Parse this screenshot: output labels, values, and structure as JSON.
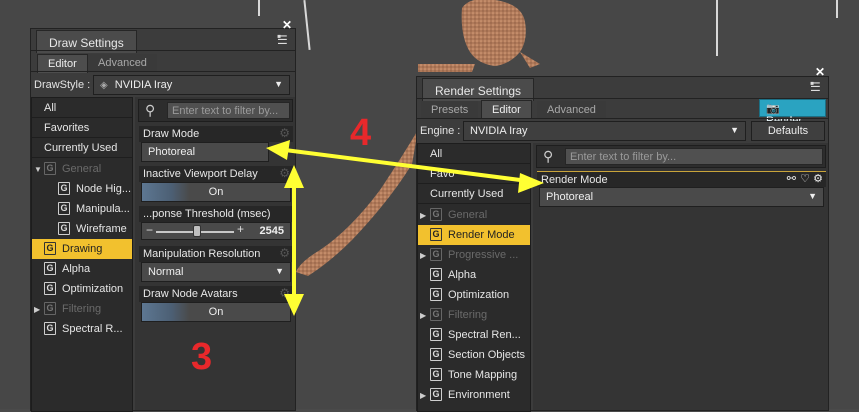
{
  "draw_panel": {
    "title": "Draw Settings",
    "tabs": [
      "Editor",
      "Advanced"
    ],
    "drawstyle_label": "DrawStyle :",
    "drawstyle_value": "NVIDIA Iray",
    "search_placeholder": "Enter text to filter by...",
    "sidebar": {
      "plain_items": [
        "All",
        "Favorites",
        "Currently Used"
      ],
      "groups": [
        {
          "label": "General",
          "expanded": true,
          "dim": true
        },
        {
          "label": "Node Hig...",
          "child": true
        },
        {
          "label": "Manipula...",
          "child": true
        },
        {
          "label": "Wireframe",
          "child": true
        },
        {
          "label": "Drawing",
          "selected": true
        },
        {
          "label": "Alpha"
        },
        {
          "label": "Optimization"
        },
        {
          "label": "Filtering",
          "dim": true
        },
        {
          "label": "Spectral R..."
        }
      ]
    },
    "properties": {
      "draw_mode_label": "Draw Mode",
      "draw_mode_value": "Photoreal",
      "inactive_delay_label": "Inactive Viewport Delay",
      "inactive_delay_value": "On",
      "threshold_label": "...ponse Threshold (msec)",
      "threshold_value": "2545",
      "manip_res_label": "Manipulation Resolution",
      "manip_res_value": "Normal",
      "avatars_label": "Draw Node Avatars",
      "avatars_value": "On"
    }
  },
  "render_panel": {
    "title": "Render Settings",
    "tabs": [
      "Presets",
      "Editor",
      "Advanced"
    ],
    "render_button": "Render",
    "engine_label": "Engine :",
    "engine_value": "NVIDIA Iray",
    "defaults_button": "Defaults",
    "search_placeholder": "Enter text to filter by...",
    "sidebar": {
      "plain_items": [
        "All",
        "Favo",
        "Currently Used"
      ],
      "groups": [
        {
          "label": "General",
          "dim": true
        },
        {
          "label": "Render Mode",
          "selected": true
        },
        {
          "label": "Progressive ...",
          "dim": true
        },
        {
          "label": "Alpha"
        },
        {
          "label": "Optimization"
        },
        {
          "label": "Filtering",
          "dim": true
        },
        {
          "label": "Spectral Ren..."
        },
        {
          "label": "Section Objects"
        },
        {
          "label": "Tone Mapping"
        },
        {
          "label": "Environment"
        }
      ]
    },
    "properties": {
      "render_mode_label": "Render Mode",
      "render_mode_value": "Photoreal"
    }
  },
  "annotations": {
    "step_3": "3",
    "step_4": "4"
  },
  "colors": {
    "selected": "#f2c12e",
    "arrow": "#ffff33",
    "annotation": "#e8282b",
    "render_button": "#2aa3c1"
  }
}
